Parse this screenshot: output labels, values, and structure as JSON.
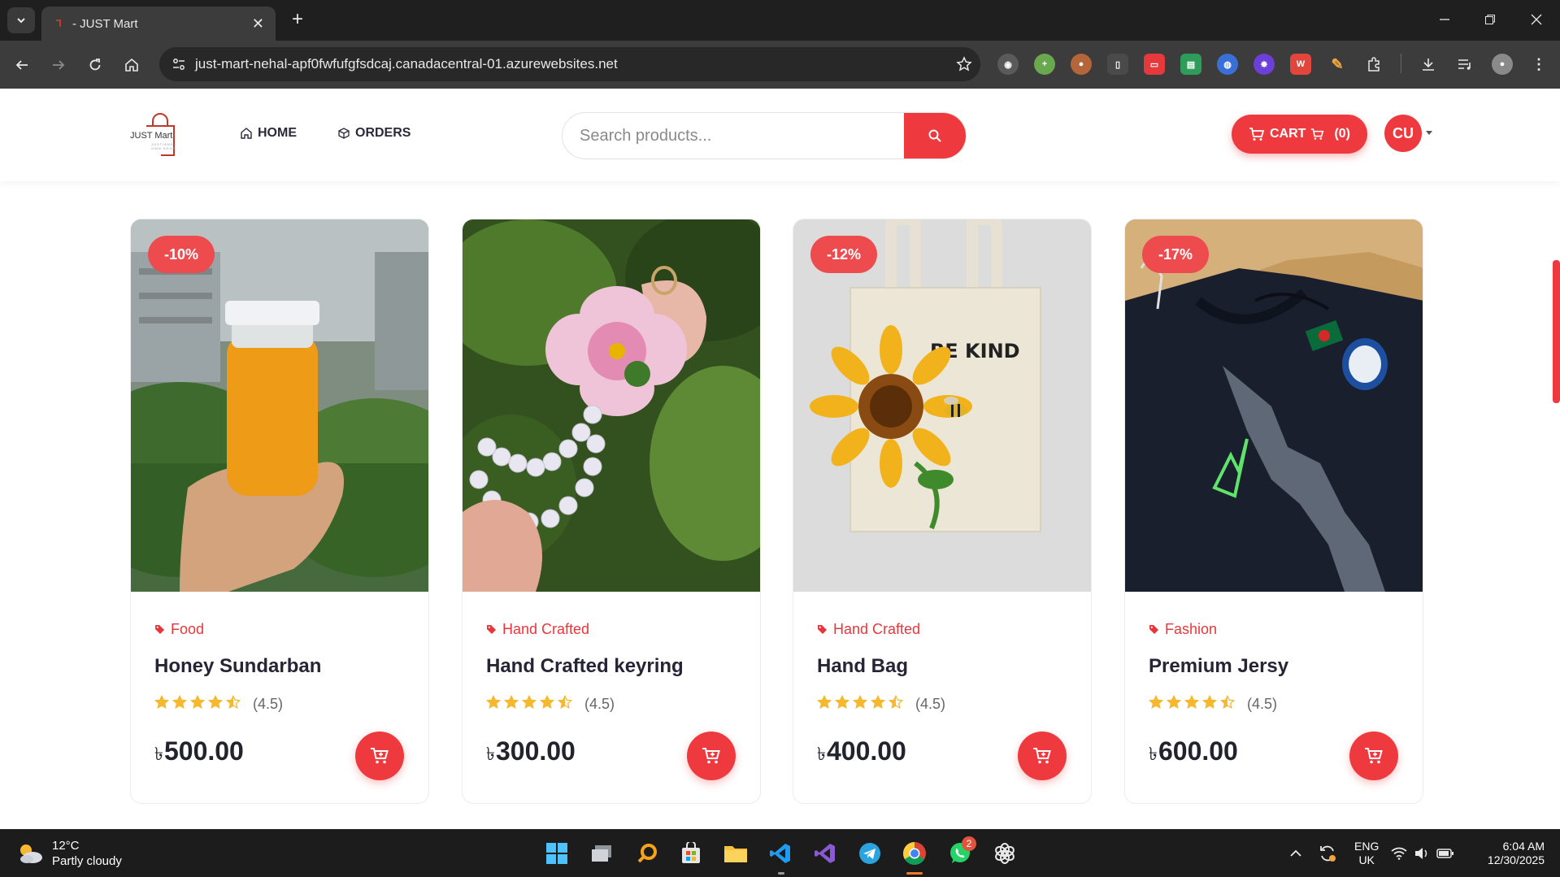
{
  "browser": {
    "tab_title": "- JUST Mart",
    "url": "just-mart-nehal-apf0fwfufgfsdcaj.canadacentral-01.azurewebsites.net",
    "extensions": [
      "owl-extension-icon",
      "plus-extension-icon",
      "cookie-extension-icon",
      "mouse-extension-icon",
      "recorder-extension-icon",
      "docs-extension-icon",
      "globe-extension-icon",
      "star-extension-icon",
      "w-extension-icon",
      "pen-extension-icon",
      "puzzle-icon"
    ]
  },
  "header": {
    "logo_text": "JUST Mart",
    "logo_sub": "JUSTIANS OWN SHOP",
    "nav": [
      {
        "label": "HOME",
        "icon": "home-icon"
      },
      {
        "label": "ORDERS",
        "icon": "box-icon"
      }
    ],
    "search_placeholder": "Search products...",
    "cart_label": "CART",
    "cart_count": "(0)",
    "user_initials": "CU"
  },
  "products": [
    {
      "name": "Honey Sundarban",
      "category": "Food",
      "discount": "-10%",
      "rating": "(4.5)",
      "rating_value": 4.5,
      "price": "500.00",
      "currency": "৳",
      "image": "honey-jar-photo"
    },
    {
      "name": "Hand Crafted keyring",
      "category": "Hand Crafted",
      "discount": "",
      "rating": "(4.5)",
      "rating_value": 4.5,
      "price": "300.00",
      "currency": "৳",
      "image": "flower-keyring-photo"
    },
    {
      "name": "Hand Bag",
      "category": "Hand Crafted",
      "discount": "-12%",
      "rating": "(4.5)",
      "rating_value": 4.5,
      "price": "400.00",
      "currency": "৳",
      "image": "tote-bag-photo",
      "bag_print": "BE KIND"
    },
    {
      "name": "Premium Jersy",
      "category": "Fashion",
      "discount": "-17%",
      "rating": "(4.5)",
      "rating_value": 4.5,
      "price": "600.00",
      "currency": "৳",
      "image": "jersey-photo"
    }
  ],
  "taskbar": {
    "weather_temp": "12°C",
    "weather_desc": "Partly cloudy",
    "lang_top": "ENG",
    "lang_bottom": "UK",
    "time": "6:04 AM",
    "date": "12/30/2025",
    "whatsapp_badge": "2"
  },
  "colors": {
    "accent": "#ee3a3f",
    "star": "#f5b82e",
    "chrome_dark": "#1f1f1f",
    "chrome_toolbar": "#3c3c3c"
  }
}
